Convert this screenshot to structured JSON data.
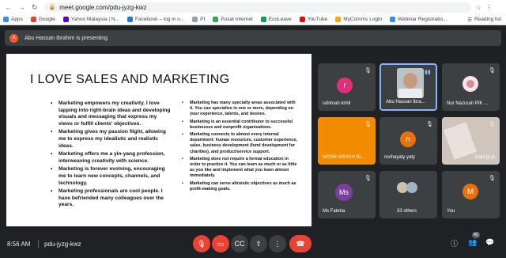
{
  "browser": {
    "url": "meet.google.com/pdu-jyzg-kwz",
    "bookmarks": [
      {
        "label": "Apps",
        "color": "#4285f4"
      },
      {
        "label": "Google",
        "color": "#ea4335"
      },
      {
        "label": "Yahoo Malaysia | N...",
        "color": "#6001d2"
      },
      {
        "label": "Facebook – log in o...",
        "color": "#1877f2"
      },
      {
        "label": "PI",
        "color": "#9aa0a6"
      },
      {
        "label": "Pusat Internet",
        "color": "#34a853"
      },
      {
        "label": "EcoLeave",
        "color": "#0f9d58"
      },
      {
        "label": "YouTube",
        "color": "#ff0000"
      },
      {
        "label": "MyComms Login",
        "color": "#f9ab00"
      },
      {
        "label": "Webinar Registratio...",
        "color": "#2d8cff"
      }
    ],
    "reading_list": "Reading list"
  },
  "presenting": {
    "avatar_letter": "A",
    "text": "Abu Hassan Ibrahim is presenting"
  },
  "slide": {
    "title": "I LOVE SALES AND MARKETING",
    "left_bullets": [
      "Marketing empowers my creativity. I love tapping into right-brain ideas and developing visuals and messaging that express my views or fulfill clients' objectives.",
      "Marketing gives my passion flight, allowing me to express my idealistic and realistic ideas.",
      "Marketing offers me a yin-yang profession, interweaving creativity with science.",
      "Marketing is forever evolving, encouraging me to learn new concepts, channels, and technology.",
      "Marketing professionals are cool people. I have befriended many colleagues over the years."
    ],
    "right_bullets": [
      "Marketing has many specialty areas associated with it. You can specialize in one or more, depending on your experience, talents, and desires.",
      "Marketing is an essential contributor to successful businesses and nonprofit organizations.",
      "Marketing connects to almost every internal department: human resources, customer experience, sales, business development (fund development for charities), and product/service support.",
      "Marketing does not require a formal education in order to practice it. You can learn as much or as little as you like and implement what you learn almost immediately.",
      "Marketing can serve altruistic objectives as much as profit-making goals."
    ]
  },
  "participants": [
    {
      "name": "rahimah kimli",
      "letter": "r",
      "color": "#e0307a"
    },
    {
      "name": "Abu Hassan Ibra...",
      "letter": "",
      "color": "#8ab4f8"
    },
    {
      "name": "Nur Nazurah PIK ...",
      "letter": "",
      "color": ""
    },
    {
      "name": "NOOR AISYAH BI...",
      "letter": "",
      "color": "#f28b00"
    },
    {
      "name": "norhayaty yaty",
      "letter": "n",
      "color": "#e8710a"
    },
    {
      "name": "Dani jp jp",
      "letter": "",
      "color": ""
    },
    {
      "name": "Ms Fateha",
      "letter": "Ms",
      "color": "#7b3fa0"
    },
    {
      "name": "33 others",
      "letter": "",
      "color": ""
    },
    {
      "name": "You",
      "letter": "M",
      "color": "#e8710a"
    }
  ],
  "bottom": {
    "time": "8:56 AM",
    "meeting_code": "pdu-jyzg-kwz",
    "people_count": "42"
  }
}
